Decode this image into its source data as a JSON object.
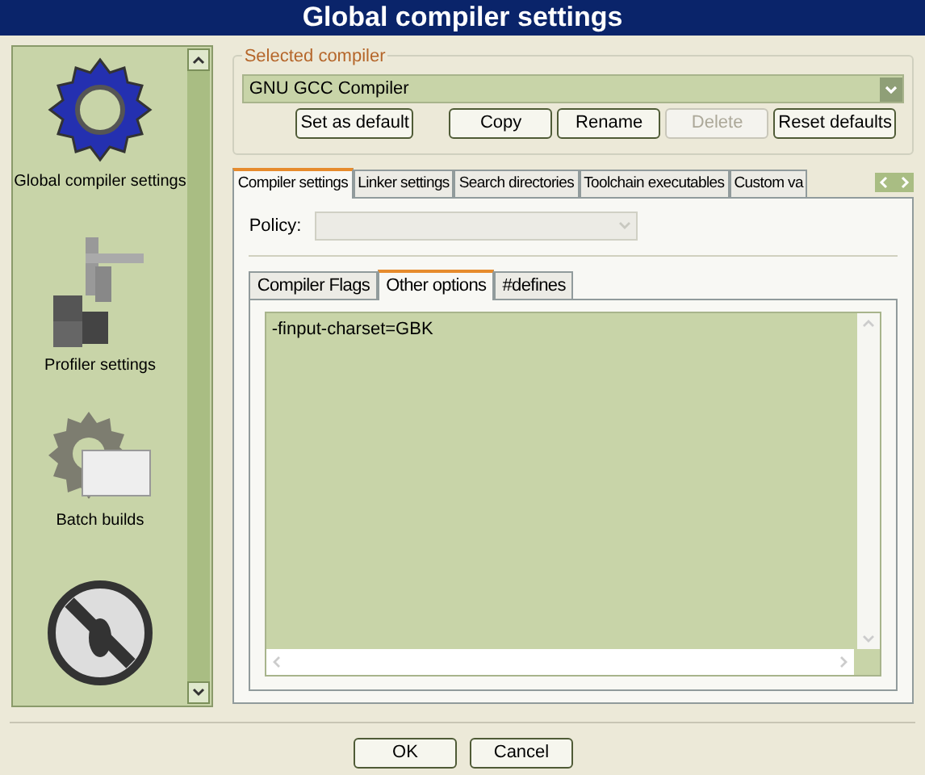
{
  "window": {
    "title": "Global compiler settings"
  },
  "sidebar": {
    "items": [
      {
        "kind": "gear",
        "label": "Global compiler settings"
      },
      {
        "kind": "profiler",
        "label": "Profiler settings"
      },
      {
        "kind": "batch",
        "label": "Batch builds"
      },
      {
        "kind": "nodebug"
      }
    ]
  },
  "selected_compiler": {
    "title": "Selected compiler",
    "value": "GNU GCC Compiler",
    "buttons": [
      {
        "label": "Set as default",
        "disabled": false
      },
      {
        "label": "Copy",
        "disabled": false
      },
      {
        "label": "Rename",
        "disabled": false
      },
      {
        "label": "Delete",
        "disabled": true
      },
      {
        "label": "Reset defaults",
        "disabled": false
      }
    ]
  },
  "tabs": [
    {
      "label": "Compiler settings",
      "selected": true
    },
    {
      "label": "Linker settings",
      "selected": false
    },
    {
      "label": "Search directories",
      "selected": false
    },
    {
      "label": "Toolchain executables",
      "selected": false
    },
    {
      "label": "Custom va",
      "selected": false
    }
  ],
  "policy": {
    "label": "Policy:",
    "disabled": true
  },
  "inner_tabs": [
    {
      "label": "Compiler Flags",
      "selected": false
    },
    {
      "label": "Other options",
      "selected": true
    },
    {
      "label": "#defines",
      "selected": false
    }
  ],
  "other_options": {
    "value": "-finput-charset=GBK"
  },
  "footer_buttons": [
    {
      "label": "OK"
    },
    {
      "label": "Cancel"
    }
  ]
}
